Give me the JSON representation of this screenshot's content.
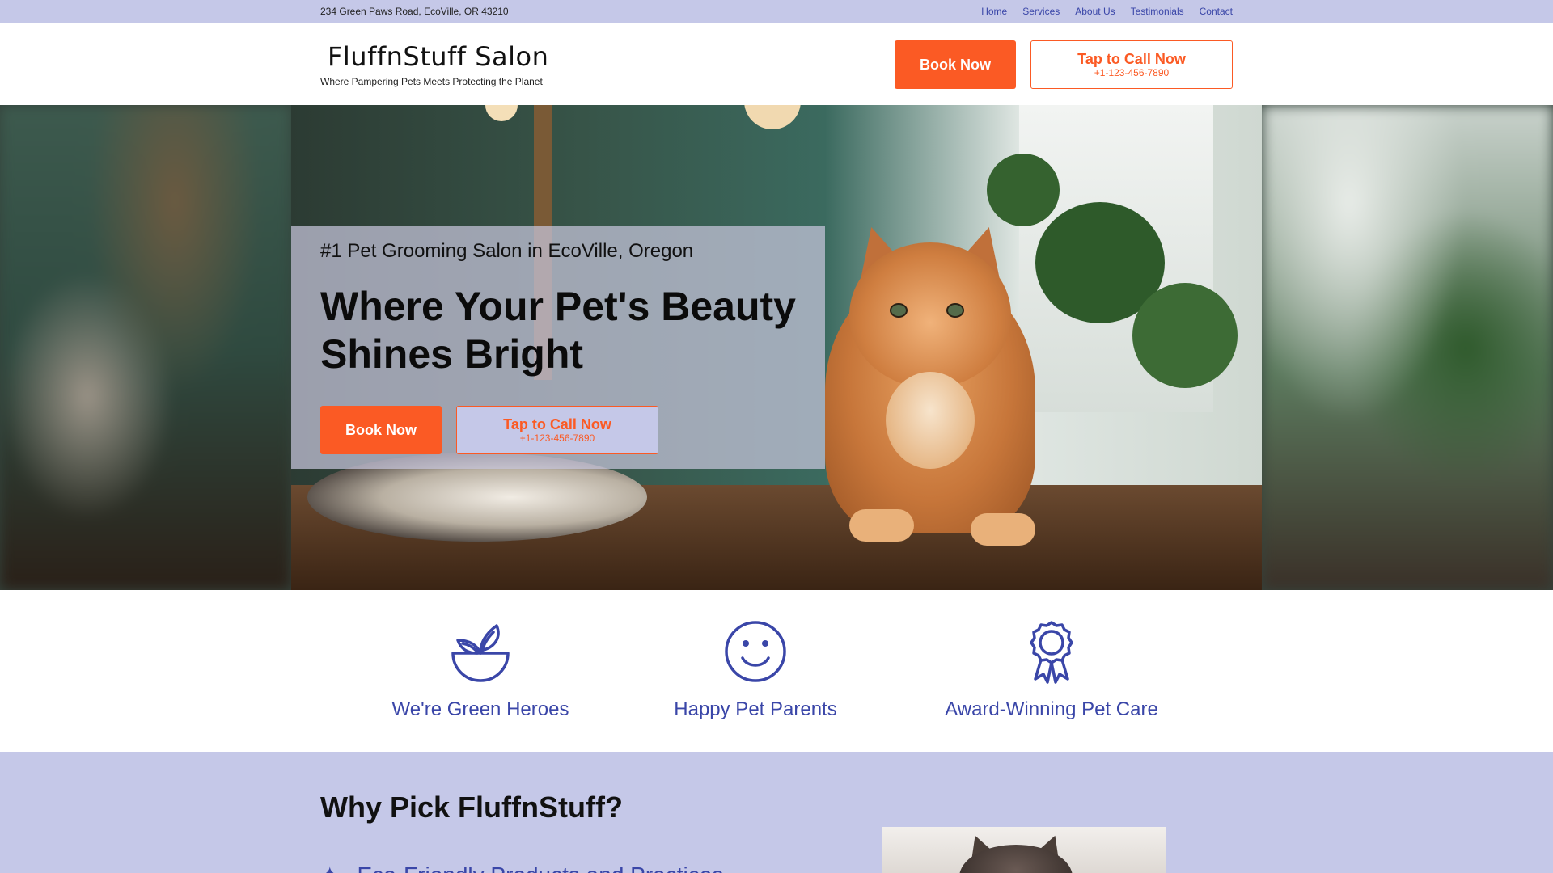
{
  "topbar": {
    "address": "234 Green Paws Road, EcoVille, OR 43210",
    "nav": [
      "Home",
      "Services",
      "About Us",
      "Testimonials",
      "Contact"
    ]
  },
  "header": {
    "brand": "FluffnStuff Salon",
    "tagline": "Where Pampering Pets Meets Protecting the Planet",
    "book_label": "Book Now",
    "call_label": "Tap to Call Now",
    "call_number": "+1-123-456-7890"
  },
  "hero": {
    "subtitle": "#1 Pet Grooming Salon in EcoVille, Oregon",
    "title": "Where Your Pet's Beauty Shines Bright",
    "book_label": "Book Now",
    "call_label": "Tap to Call Now",
    "call_number": "+1-123-456-7890"
  },
  "features": [
    {
      "icon": "plant-bowl-icon",
      "label": "We're Green Heroes"
    },
    {
      "icon": "smiley-face-icon",
      "label": "Happy Pet Parents"
    },
    {
      "icon": "award-ribbon-icon",
      "label": "Award-Winning Pet Care"
    }
  ],
  "why": {
    "title": "Why Pick FluffnStuff?",
    "first_item": "Eco-Friendly Products and Practices"
  },
  "colors": {
    "accent": "#fb5a24",
    "brand_blue": "#3a46a8",
    "band": "#c5c8e8"
  }
}
